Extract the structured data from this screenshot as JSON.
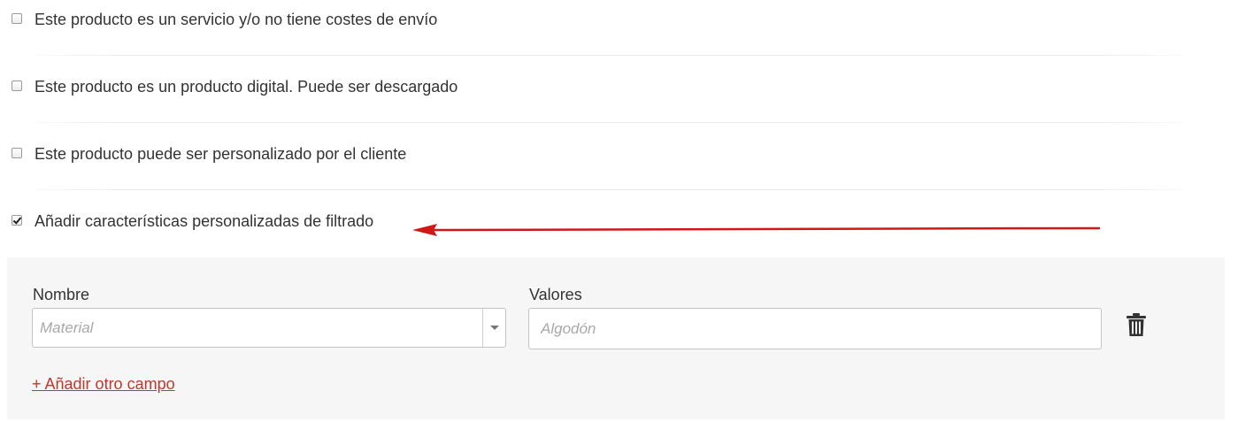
{
  "options": [
    {
      "label": "Este producto es un servicio y/o no tiene costes de envío",
      "checked": false
    },
    {
      "label": "Este producto es un producto digital. Puede ser descargado",
      "checked": false
    },
    {
      "label": "Este producto puede ser personalizado por el cliente",
      "checked": false
    },
    {
      "label": "Añadir características personalizadas de filtrado",
      "checked": true
    }
  ],
  "filter_panel": {
    "name_label": "Nombre",
    "name_placeholder": "Material",
    "values_label": "Valores",
    "values_placeholder": "Algodón",
    "add_field_link": "+ Añadir otro campo"
  },
  "colors": {
    "annotation_arrow": "#d01818",
    "link": "#c0392b",
    "panel_background": "#f6f6f6"
  }
}
